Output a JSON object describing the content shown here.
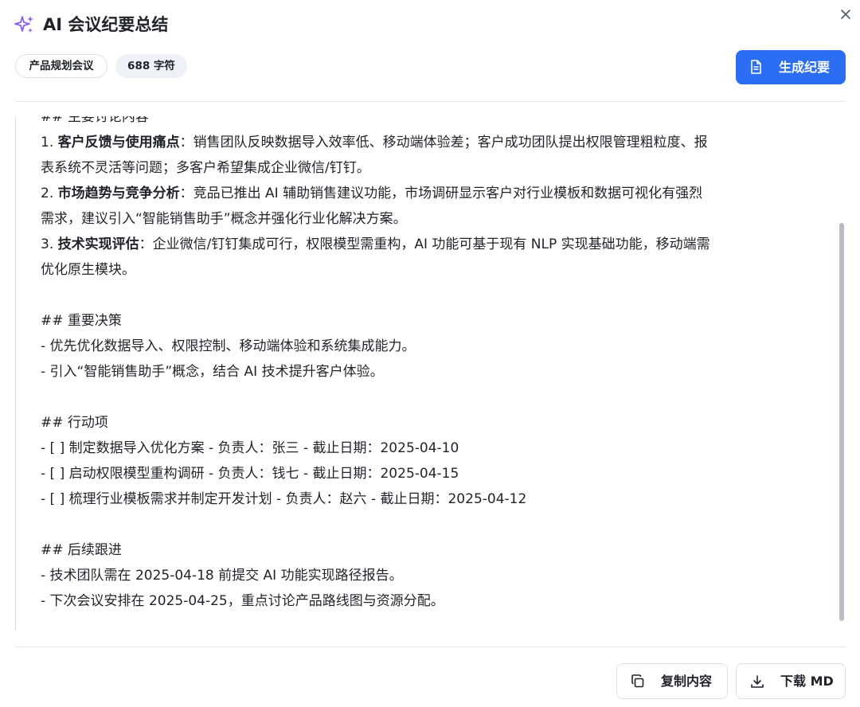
{
  "dialog": {
    "title": "AI 会议纪要总结",
    "close_icon": "close-icon",
    "title_icon": "sparkle-icon",
    "accent_color": "#2b6df3",
    "icon_color": "#8b5cf6"
  },
  "meta": {
    "topic_tag": "产品规划会议",
    "char_count": "688 字符"
  },
  "actions": {
    "generate_label": "生成纪要",
    "generate_icon": "document-icon",
    "copy_label": "复制内容",
    "copy_icon": "copy-icon",
    "download_label": "下载 MD",
    "download_icon": "download-icon"
  },
  "content": {
    "sec_discussion": "## 主要讨论内容",
    "item1_num": "1. ",
    "item1_title": "客户反馈与使用痛点",
    "item1_text_a": "：销售团队反映数据导入效率低、移动端体验差；客户成功团队提出权限管理粗粒度、报",
    "item1_text_b": "表系统不灵活等问题；多客户希望集成企业微信/钉钉。",
    "item2_num": "2. ",
    "item2_title": "市场趋势与竞争分析",
    "item2_text_a": "：竞品已推出 AI 辅助销售建议功能，市场调研显示客户对行业模板和数据可视化有强烈",
    "item2_text_b": "需求，建议引入“智能销售助手”概念并强化行业化解决方案。",
    "item3_num": "3. ",
    "item3_title": "技术实现评估",
    "item3_text_a": "：企业微信/钉钉集成可行，权限模型需重构，AI 功能可基于现有 NLP 实现基础功能，移动端需",
    "item3_text_b": "优化原生模块。",
    "sec_decisions": "## 重要决策",
    "decision_1": "- 优先优化数据导入、权限控制、移动端体验和系统集成能力。",
    "decision_2": "- 引入“智能销售助手”概念，结合 AI 技术提升客户体验。",
    "sec_actions": "## 行动项",
    "action_1": "- [ ] 制定数据导入优化方案 - 负责人：张三 - 截止日期：2025-04-10",
    "action_2": "- [ ] 启动权限模型重构调研 - 负责人：钱七 - 截止日期：2025-04-15",
    "action_3": "- [ ] 梳理行业模板需求并制定开发计划 - 负责人：赵六 - 截止日期：2025-04-12",
    "sec_followup": "## 后续跟进",
    "followup_1": "- 技术团队需在 2025-04-18 前提交 AI 功能实现路径报告。",
    "followup_2": "- 下次会议安排在 2025-04-25，重点讨论产品路线图与资源分配。"
  }
}
